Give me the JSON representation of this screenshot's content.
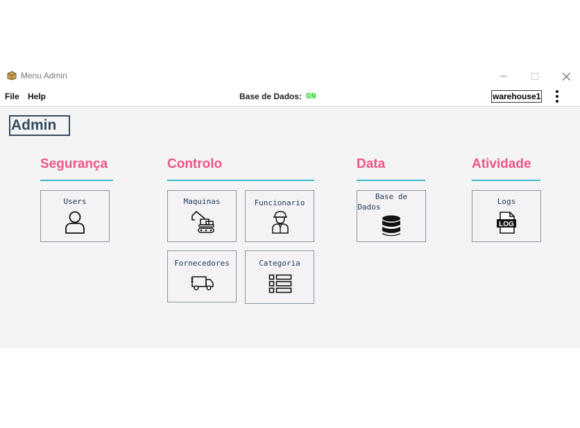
{
  "window": {
    "title": "Menu Admin",
    "controls": [
      "minimize-icon",
      "maximize-icon",
      "close-icon"
    ]
  },
  "menubar": {
    "file": "File",
    "help": "Help",
    "db_label": "Base de Dados:",
    "db_status": "ON",
    "user": "warehouse1",
    "more": "more-vert-icon"
  },
  "page": {
    "title": "Admin"
  },
  "sections": {
    "seguranca": {
      "title": "Segurança",
      "tiles": {
        "users": {
          "label": "Users",
          "icon": "user-icon"
        }
      }
    },
    "controlo": {
      "title": "Controlo",
      "tiles": {
        "maquinas": {
          "label": "Maquinas",
          "icon": "excavator-icon"
        },
        "funcionario": {
          "label": "Funcionario",
          "icon": "worker-icon"
        },
        "fornecedores": {
          "label": "Fornecedores",
          "icon": "truck-icon"
        },
        "categoria": {
          "label": "Categoria",
          "icon": "list-icon"
        }
      }
    },
    "data": {
      "title": "Data",
      "tiles": {
        "basedados": {
          "label_line1": "Base de",
          "label_line2": "Dados",
          "icon": "database-icon"
        }
      }
    },
    "atividade": {
      "title": "Atividade",
      "tiles": {
        "logs": {
          "label": "Logs",
          "icon": "log-file-icon",
          "icon_text": "LOG"
        }
      }
    }
  },
  "colors": {
    "section_title": "#ee5587",
    "section_line": "#3bb6c7",
    "db_on": "#16d616",
    "admin_title": "#34495e"
  }
}
